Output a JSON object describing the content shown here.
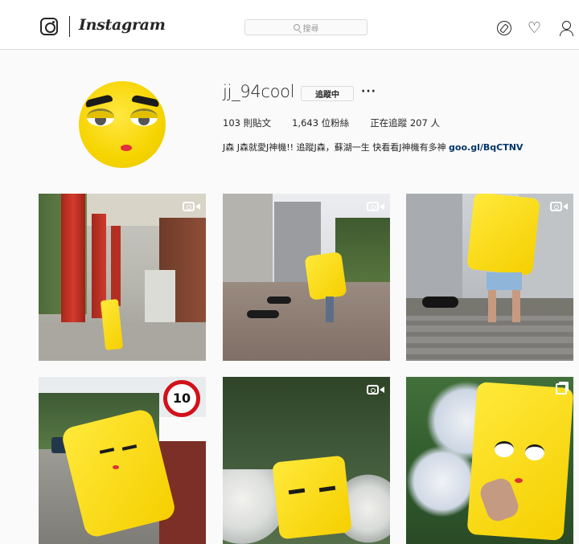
{
  "header": {
    "wordmark": "Instagram",
    "search_placeholder": "搜尋"
  },
  "profile": {
    "username": "jj_94cool",
    "following_button": "追蹤中",
    "more_button": "···",
    "stats": {
      "posts": "103 則貼文",
      "followers": "1,643 位粉絲",
      "following": "正在追蹤 207 人"
    },
    "bio": "J森 J森就愛J神機!! 追蹤J森，蘇湖一生 快看看J神機有多神",
    "bio_link": "goo.gl/BqCTNV"
  },
  "posts": [
    {
      "badge": "video"
    },
    {
      "badge": "video"
    },
    {
      "badge": "video"
    },
    {
      "badge": "none",
      "sign_text": "10"
    },
    {
      "badge": "video"
    },
    {
      "badge": "multiple"
    }
  ],
  "colors": {
    "accent_yellow": "#f5d000",
    "link": "#003569",
    "border": "#dbdbdb"
  }
}
